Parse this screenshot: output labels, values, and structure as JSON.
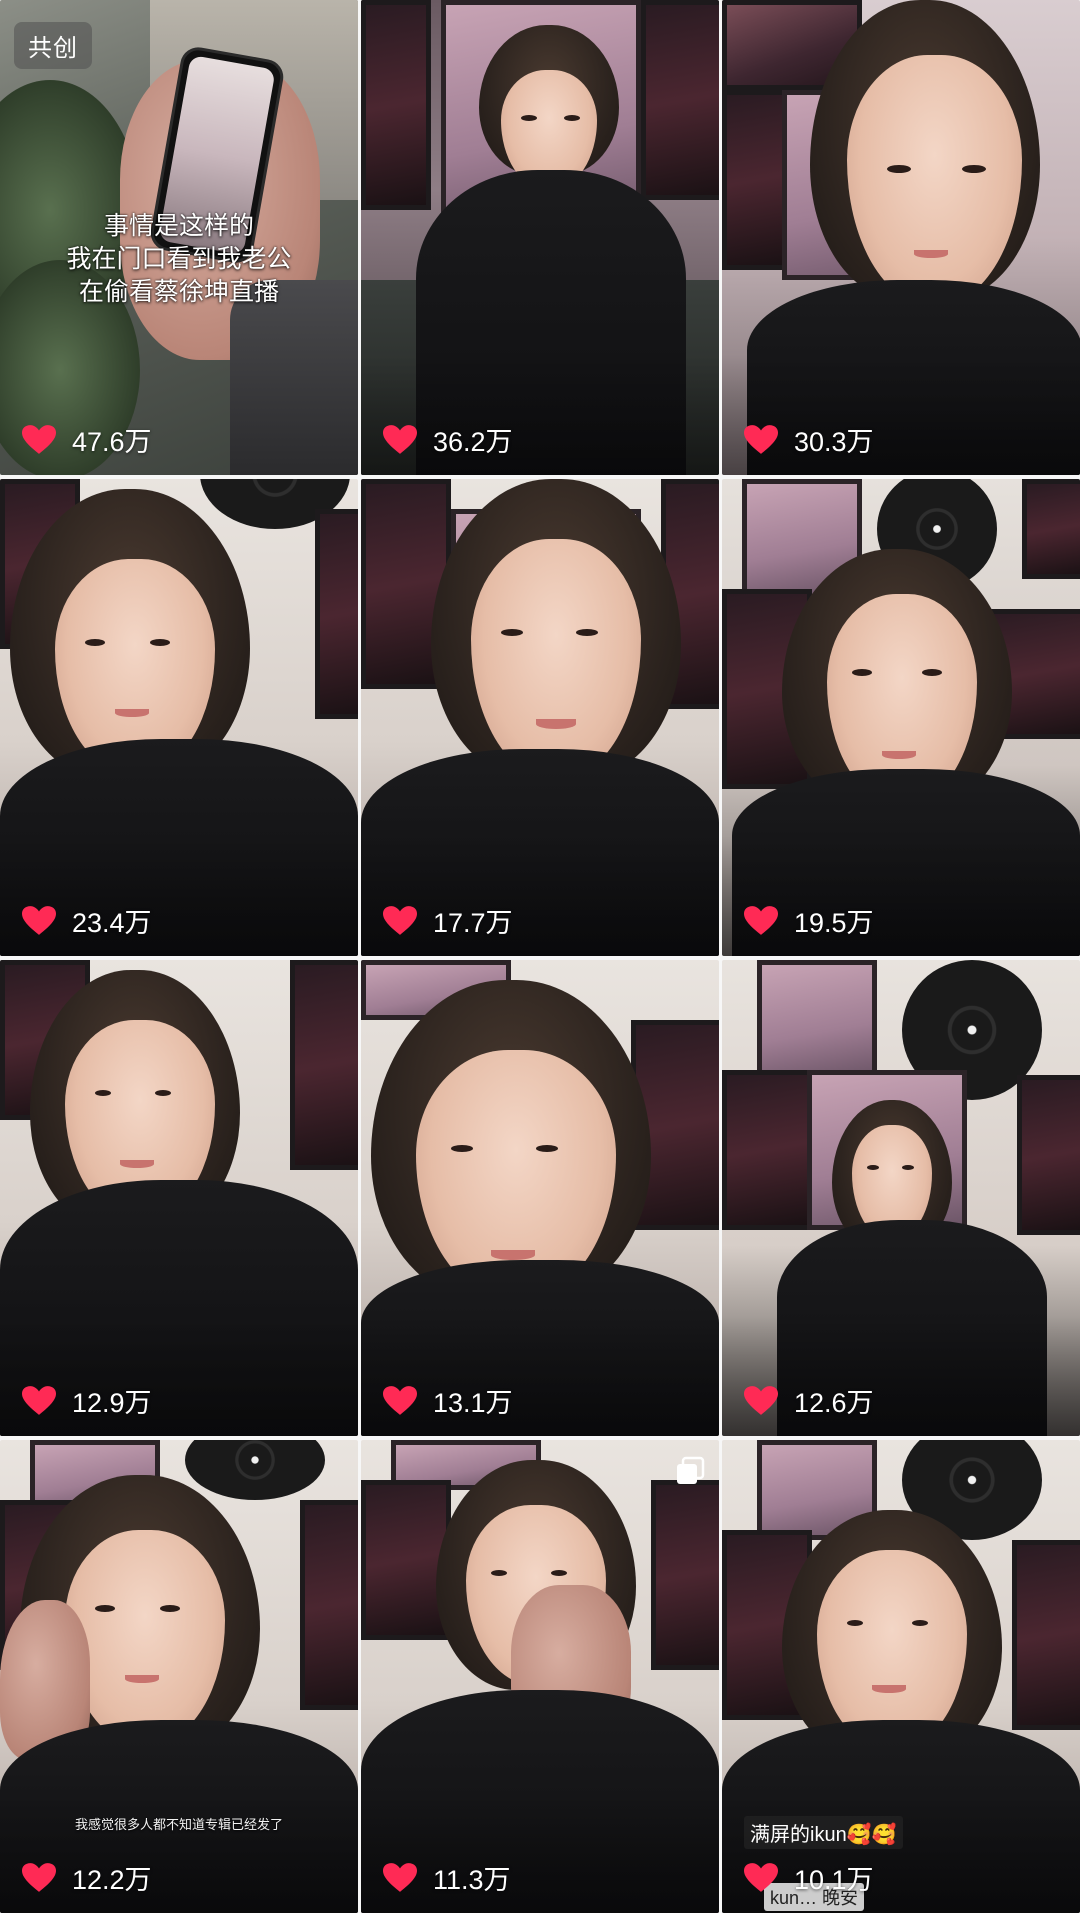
{
  "badge": "共创",
  "caption_lines": [
    "事情是这样的",
    "我在门口看到我老公",
    "在偷看蔡徐坤直播"
  ],
  "accent_heart_color": "#ff2a55",
  "items": [
    {
      "likes": "47.6万"
    },
    {
      "likes": "36.2万"
    },
    {
      "likes": "30.3万"
    },
    {
      "likes": "23.4万"
    },
    {
      "likes": "17.7万"
    },
    {
      "likes": "19.5万"
    },
    {
      "likes": "12.9万"
    },
    {
      "likes": "13.1万"
    },
    {
      "likes": "12.6万"
    },
    {
      "likes": "12.2万"
    },
    {
      "likes": "11.3万"
    },
    {
      "likes": "10.1万"
    }
  ],
  "subtitle_cell_10": "我感觉很多人都不知道专辑已经发了",
  "chat_overlay_cell_12": "满屏的ikun🥰🥰",
  "chat_overlay_cell_12_second": "kun… 晚安",
  "icons": {
    "like": "heart-icon",
    "multi": "multi-image-icon"
  }
}
